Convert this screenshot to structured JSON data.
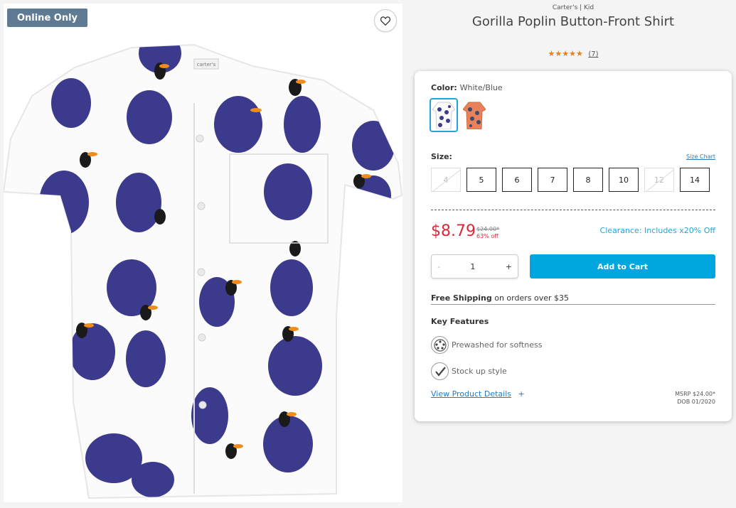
{
  "badge": "Online Only",
  "product": {
    "brand": "Carter's | Kid",
    "title": "Gorilla Poplin Button-Front Shirt",
    "stars": "★★★★★",
    "rating": 5,
    "review_count": "(7)",
    "label_text": "carter's"
  },
  "color": {
    "label": "Color:",
    "value": "White/Blue"
  },
  "size": {
    "label": "Size:",
    "chart_link": "Size Chart",
    "options": [
      "4",
      "5",
      "6",
      "7",
      "8",
      "10",
      "12",
      "14"
    ],
    "unavailable": [
      "4",
      "12"
    ]
  },
  "pricing": {
    "price": "$8.79",
    "original": "$24.00*",
    "discount": "63% off",
    "clearance": "Clearance: Includes x20% Off"
  },
  "quantity": {
    "minus": "-",
    "value": "1",
    "plus": "+"
  },
  "add_to_cart": "Add to Cart",
  "shipping": {
    "bold": "Free Shipping",
    "rest": " on orders over $35"
  },
  "features": {
    "heading": "Key Features",
    "items": [
      {
        "icon": "laundry-icon",
        "label": "Prewashed for softness"
      },
      {
        "icon": "check-icon",
        "label": "Stock up style"
      }
    ]
  },
  "details_link": "View Product Details",
  "details_plus": "+",
  "msrp": {
    "line1": "MSRP $24.00*",
    "line2": "DOB 01/2020"
  },
  "colors": {
    "accent": "#00a6e0",
    "sale": "#d92a3a",
    "badge": "#5f7a93",
    "star": "#e37f1c"
  }
}
